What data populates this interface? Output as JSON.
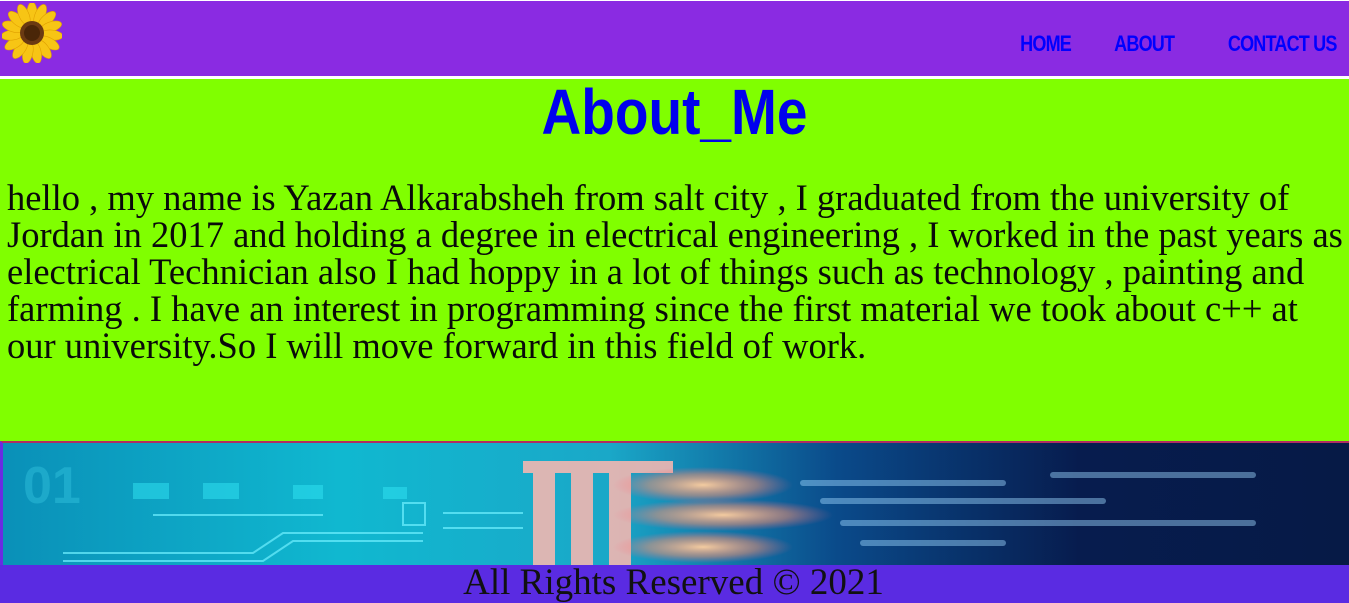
{
  "header": {
    "logo_icon": "sunflower-icon",
    "nav": [
      {
        "label": "HOME"
      },
      {
        "label": "ABOUT"
      },
      {
        "label": "CONTACT US"
      }
    ]
  },
  "main": {
    "title": "About_Me",
    "bio": "hello , my name is Yazan Alkarabsheh from salt city , I graduated from the university of Jordan in 2017 and holding a degree in electrical engineering , I worked in the past years as electrical Technician also I had hoppy in a lot of things such as technology , painting and farming . I have an interest in programming since the first material we took about c++ at our university.So I will move forward in this field of work."
  },
  "banner": {
    "image": "circuit-board-technology-banner"
  },
  "footer": {
    "text": "All Rights Reserved © 2021"
  },
  "colors": {
    "header_bg": "#8a2be2",
    "main_bg": "#80ff00",
    "title_color": "#0000ee",
    "nav_color": "#0000ff",
    "footer_bg": "#5a2be2"
  }
}
